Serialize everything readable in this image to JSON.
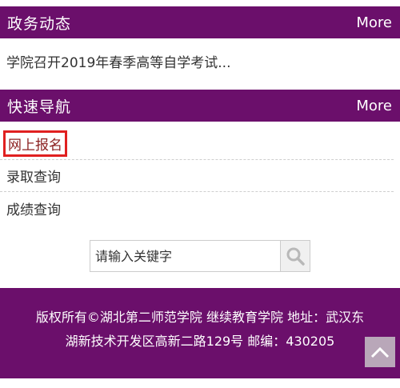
{
  "news": {
    "title": "政务动态",
    "more": "More",
    "items": [
      "学院召开2019年春季高等自学考试..."
    ]
  },
  "quick_nav": {
    "title": "快速导航",
    "more": "More",
    "items": [
      "网上报名",
      "录取查询",
      "成绩查询"
    ]
  },
  "search": {
    "placeholder": "请输入关键字",
    "icon": "search-icon"
  },
  "footer": {
    "line1": "版权所有©湖北第二师范学院 继续教育学院   地址：武汉东",
    "line2": "湖新技术开发区高新二路129号 邮编：430205"
  },
  "back_to_top": {
    "icon": "chevron-up-icon"
  },
  "colors": {
    "brand": "#6b0f6b",
    "highlight": "#e02020"
  }
}
